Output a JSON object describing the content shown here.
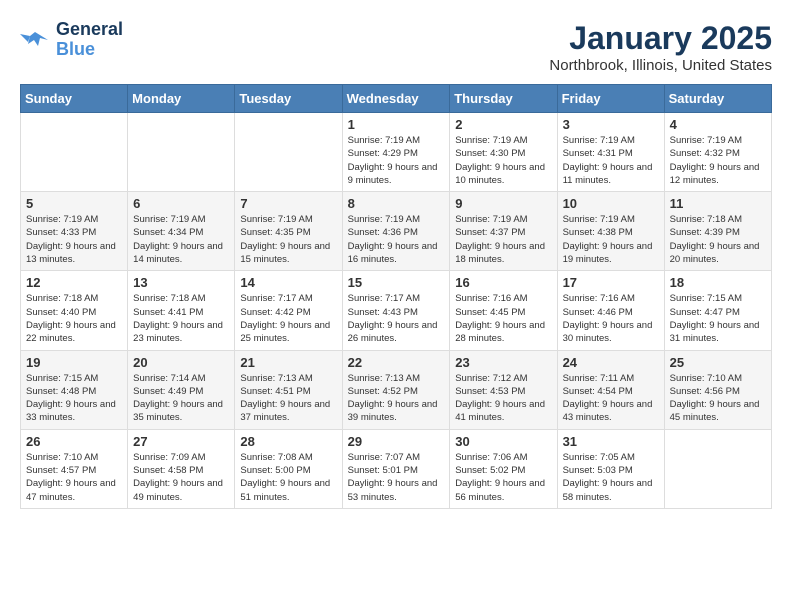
{
  "header": {
    "logo_line1": "General",
    "logo_line2": "Blue",
    "month": "January 2025",
    "location": "Northbrook, Illinois, United States"
  },
  "days_of_week": [
    "Sunday",
    "Monday",
    "Tuesday",
    "Wednesday",
    "Thursday",
    "Friday",
    "Saturday"
  ],
  "weeks": [
    [
      {
        "day": "",
        "text": ""
      },
      {
        "day": "",
        "text": ""
      },
      {
        "day": "",
        "text": ""
      },
      {
        "day": "1",
        "text": "Sunrise: 7:19 AM\nSunset: 4:29 PM\nDaylight: 9 hours and 9 minutes."
      },
      {
        "day": "2",
        "text": "Sunrise: 7:19 AM\nSunset: 4:30 PM\nDaylight: 9 hours and 10 minutes."
      },
      {
        "day": "3",
        "text": "Sunrise: 7:19 AM\nSunset: 4:31 PM\nDaylight: 9 hours and 11 minutes."
      },
      {
        "day": "4",
        "text": "Sunrise: 7:19 AM\nSunset: 4:32 PM\nDaylight: 9 hours and 12 minutes."
      }
    ],
    [
      {
        "day": "5",
        "text": "Sunrise: 7:19 AM\nSunset: 4:33 PM\nDaylight: 9 hours and 13 minutes."
      },
      {
        "day": "6",
        "text": "Sunrise: 7:19 AM\nSunset: 4:34 PM\nDaylight: 9 hours and 14 minutes."
      },
      {
        "day": "7",
        "text": "Sunrise: 7:19 AM\nSunset: 4:35 PM\nDaylight: 9 hours and 15 minutes."
      },
      {
        "day": "8",
        "text": "Sunrise: 7:19 AM\nSunset: 4:36 PM\nDaylight: 9 hours and 16 minutes."
      },
      {
        "day": "9",
        "text": "Sunrise: 7:19 AM\nSunset: 4:37 PM\nDaylight: 9 hours and 18 minutes."
      },
      {
        "day": "10",
        "text": "Sunrise: 7:19 AM\nSunset: 4:38 PM\nDaylight: 9 hours and 19 minutes."
      },
      {
        "day": "11",
        "text": "Sunrise: 7:18 AM\nSunset: 4:39 PM\nDaylight: 9 hours and 20 minutes."
      }
    ],
    [
      {
        "day": "12",
        "text": "Sunrise: 7:18 AM\nSunset: 4:40 PM\nDaylight: 9 hours and 22 minutes."
      },
      {
        "day": "13",
        "text": "Sunrise: 7:18 AM\nSunset: 4:41 PM\nDaylight: 9 hours and 23 minutes."
      },
      {
        "day": "14",
        "text": "Sunrise: 7:17 AM\nSunset: 4:42 PM\nDaylight: 9 hours and 25 minutes."
      },
      {
        "day": "15",
        "text": "Sunrise: 7:17 AM\nSunset: 4:43 PM\nDaylight: 9 hours and 26 minutes."
      },
      {
        "day": "16",
        "text": "Sunrise: 7:16 AM\nSunset: 4:45 PM\nDaylight: 9 hours and 28 minutes."
      },
      {
        "day": "17",
        "text": "Sunrise: 7:16 AM\nSunset: 4:46 PM\nDaylight: 9 hours and 30 minutes."
      },
      {
        "day": "18",
        "text": "Sunrise: 7:15 AM\nSunset: 4:47 PM\nDaylight: 9 hours and 31 minutes."
      }
    ],
    [
      {
        "day": "19",
        "text": "Sunrise: 7:15 AM\nSunset: 4:48 PM\nDaylight: 9 hours and 33 minutes."
      },
      {
        "day": "20",
        "text": "Sunrise: 7:14 AM\nSunset: 4:49 PM\nDaylight: 9 hours and 35 minutes."
      },
      {
        "day": "21",
        "text": "Sunrise: 7:13 AM\nSunset: 4:51 PM\nDaylight: 9 hours and 37 minutes."
      },
      {
        "day": "22",
        "text": "Sunrise: 7:13 AM\nSunset: 4:52 PM\nDaylight: 9 hours and 39 minutes."
      },
      {
        "day": "23",
        "text": "Sunrise: 7:12 AM\nSunset: 4:53 PM\nDaylight: 9 hours and 41 minutes."
      },
      {
        "day": "24",
        "text": "Sunrise: 7:11 AM\nSunset: 4:54 PM\nDaylight: 9 hours and 43 minutes."
      },
      {
        "day": "25",
        "text": "Sunrise: 7:10 AM\nSunset: 4:56 PM\nDaylight: 9 hours and 45 minutes."
      }
    ],
    [
      {
        "day": "26",
        "text": "Sunrise: 7:10 AM\nSunset: 4:57 PM\nDaylight: 9 hours and 47 minutes."
      },
      {
        "day": "27",
        "text": "Sunrise: 7:09 AM\nSunset: 4:58 PM\nDaylight: 9 hours and 49 minutes."
      },
      {
        "day": "28",
        "text": "Sunrise: 7:08 AM\nSunset: 5:00 PM\nDaylight: 9 hours and 51 minutes."
      },
      {
        "day": "29",
        "text": "Sunrise: 7:07 AM\nSunset: 5:01 PM\nDaylight: 9 hours and 53 minutes."
      },
      {
        "day": "30",
        "text": "Sunrise: 7:06 AM\nSunset: 5:02 PM\nDaylight: 9 hours and 56 minutes."
      },
      {
        "day": "31",
        "text": "Sunrise: 7:05 AM\nSunset: 5:03 PM\nDaylight: 9 hours and 58 minutes."
      },
      {
        "day": "",
        "text": ""
      }
    ]
  ]
}
